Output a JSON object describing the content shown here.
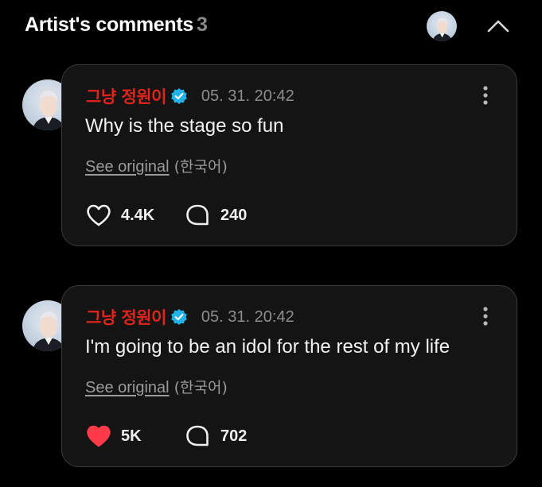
{
  "header": {
    "title": "Artist's comments",
    "count": "3",
    "avatar_icon": "artist-avatar",
    "collapse_icon": "chevron-up-icon"
  },
  "comments": [
    {
      "author": "그냥 정원이",
      "verified_icon": "verified-badge-icon",
      "timestamp": "05. 31. 20:42",
      "text": "Why is the stage so fun",
      "see_original": "See original",
      "original_language": "(한국어)",
      "likes": "4.4K",
      "liked": false,
      "replies": "240"
    },
    {
      "author": "그냥 정원이",
      "verified_icon": "verified-badge-icon",
      "timestamp": "05. 31. 20:42",
      "text": "I'm going to be an idol for the rest of my life",
      "see_original": "See original",
      "original_language": "(한국어)",
      "likes": "5K",
      "liked": true,
      "replies": "702"
    }
  ],
  "colors": {
    "background": "#000000",
    "card": "#141414",
    "card_border": "#3b3b3b",
    "author": "#e0241b",
    "verified": "#22b3e6",
    "liked_heart": "#ff3b4a",
    "muted_text": "#8d8d8d"
  }
}
